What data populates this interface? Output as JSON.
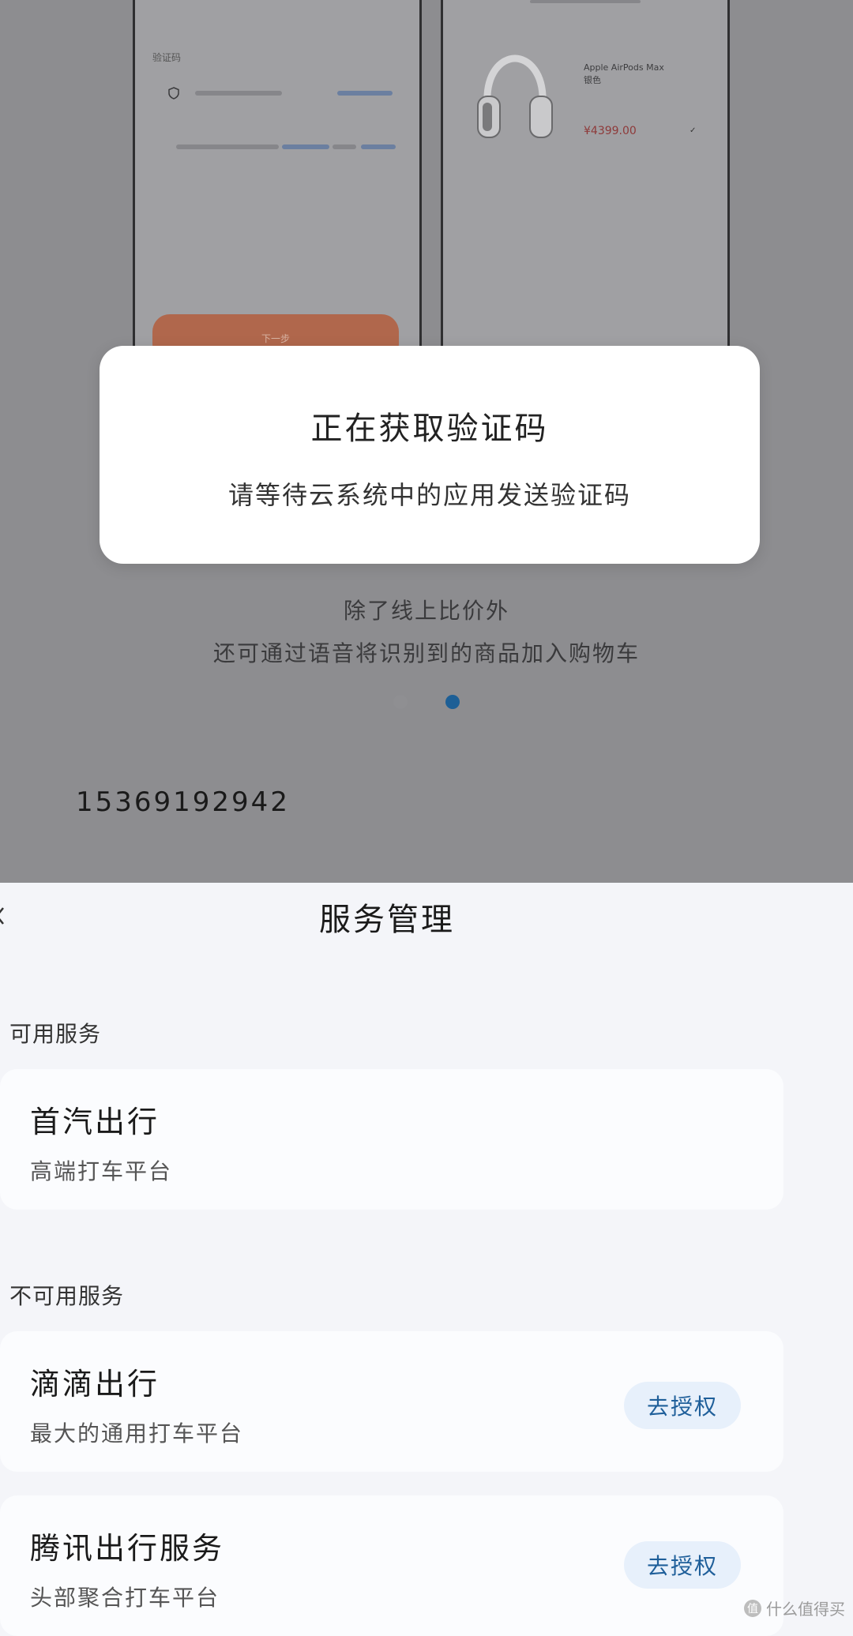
{
  "background": {
    "left_card": {
      "verify_label": "验证码",
      "next_button_label": "下一步"
    },
    "right_card": {
      "product_name": "Apple AirPods Max",
      "product_variant": "银色",
      "product_price": "¥4399.00"
    },
    "feature_lines": [
      "除了线上比价外",
      "还可通过语音将识别到的商品加入购物车"
    ],
    "carousel": {
      "total_pages": 2,
      "active_page": 2
    },
    "phone_number": "15369192942"
  },
  "toast": {
    "title": "正在获取验证码",
    "message": "请等待云系统中的应用发送验证码"
  },
  "sheet": {
    "title": "服务管理",
    "available_label": "可用服务",
    "unavailable_label": "不可用服务",
    "available_services": [
      {
        "name": "首汽出行",
        "desc": "高端打车平台"
      }
    ],
    "unavailable_services": [
      {
        "name": "滴滴出行",
        "desc": "最大的通用打车平台",
        "action": "去授权"
      },
      {
        "name": "腾讯出行服务",
        "desc": "头部聚合打车平台",
        "action": "去授权"
      }
    ]
  },
  "watermark": {
    "logo": "值",
    "text": "什么值得买"
  },
  "colors": {
    "accent": "#1f5f9a",
    "dim_overlay": "#8d8d90",
    "sheet_bg": "#f4f5f9",
    "card_bg": "#fbfcfe",
    "authorize_bg": "#e7f0fb"
  }
}
